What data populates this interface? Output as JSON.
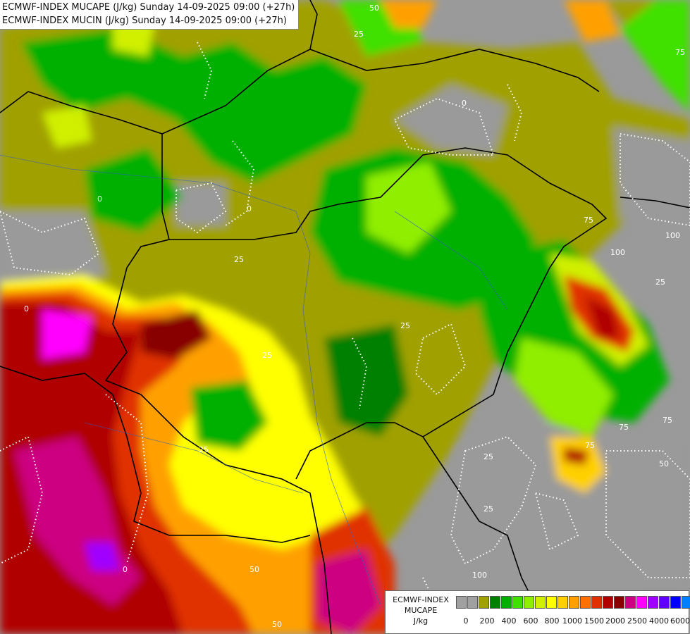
{
  "title": {
    "line1": "ECMWF-INDEX MUCAPE (J/kg) Sunday 14-09-2025 09:00 (+27h)",
    "line2": "ECMWF-INDEX MUCIN (J/kg) Sunday 14-09-2025 09:00 (+27h)"
  },
  "legend": {
    "line1": "ECMWF-INDEX",
    "line2": "MUCAPE",
    "line3": "J/kg",
    "colors": [
      "#a0a0a0",
      "#a0a0a0",
      "#a0a000",
      "#008000",
      "#00b000",
      "#40e000",
      "#90ee00",
      "#d0f000",
      "#ffff00",
      "#ffd000",
      "#ffa000",
      "#ff7000",
      "#e03000",
      "#b00000",
      "#880000",
      "#cc0080",
      "#ff00ff",
      "#a000ff",
      "#6000ff",
      "#0000ff",
      "#0080ff",
      "#00c0ff",
      "#00ffff",
      "#ffffff"
    ],
    "ticks": [
      "0",
      "200",
      "400",
      "600",
      "800",
      "1000",
      "1500",
      "2000",
      "2500",
      "4000",
      "6000"
    ]
  },
  "contour_labels": [
    "50",
    "25",
    "0",
    "0",
    "0",
    "0",
    "25",
    "25",
    "25",
    "25",
    "50",
    "75",
    "100",
    "100",
    "25",
    "75",
    "75",
    "50",
    "25",
    "0",
    "50",
    "75",
    "100",
    "25",
    "75"
  ]
}
